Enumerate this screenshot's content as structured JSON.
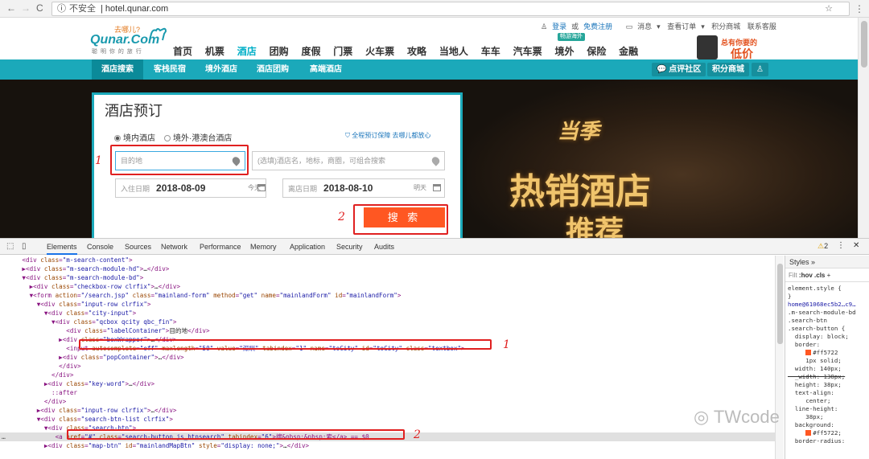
{
  "browser": {
    "back": "←",
    "forward": "→",
    "reload": "C",
    "security": "不安全",
    "url": "hotel.qunar.com",
    "star": "☆",
    "menu": "⋮"
  },
  "header": {
    "logo_top": "去哪儿?",
    "logo_main": "Qunar.Com",
    "logo_sub": "聪 明 你 的 旅 行",
    "top_links": {
      "login": "登录",
      "or": "或",
      "register": "免费注册",
      "messages": "消息",
      "orders": "查看订单",
      "points_mall": "积分商城",
      "service": "联系客服"
    },
    "ad_title": "总有你要的",
    "ad_price": "低价",
    "badge": "畅游海外"
  },
  "main_nav": [
    "首页",
    "机票",
    "酒店",
    "团购",
    "度假",
    "门票",
    "火车票",
    "攻略",
    "当地人",
    "车车",
    "汽车票",
    "境外",
    "保险",
    "金融"
  ],
  "main_nav_active": "酒店",
  "sub_nav": {
    "items": [
      "酒店搜索",
      "客栈民宿",
      "境外酒店",
      "酒店团购",
      "高端酒店"
    ],
    "active": "酒店搜索",
    "community": "点评社区",
    "points": "积分商城"
  },
  "booking": {
    "title": "酒店预订",
    "radio_domestic": "境内酒店",
    "radio_overseas": "境外·港澳台酒店",
    "guarantee": "全程预订保障 去哪儿都放心",
    "destination_placeholder": "目的地",
    "keyword_placeholder": "(选填)酒店名，地标，商圈，可组合搜索",
    "checkin_label": "入住日期",
    "checkin_date": "2018-08-09",
    "checkin_day": "今天",
    "checkout_label": "离店日期",
    "checkout_date": "2018-08-10",
    "checkout_day": "明天",
    "search": "搜 索"
  },
  "hero": {
    "line1": "当季",
    "line2": "热销酒店",
    "line3": "推荐"
  },
  "annotations": {
    "mark1": "1",
    "mark2": "2"
  },
  "devtools": {
    "tabs": [
      "Elements",
      "Console",
      "Sources",
      "Network",
      "Performance",
      "Memory",
      "Application",
      "Security",
      "Audits"
    ],
    "active_tab": "Elements",
    "warnings": "2",
    "styles_tab": "Styles",
    "filter": "Filt",
    "hov": ":hov",
    "cls": ".cls",
    "style_lines": [
      "element.style {",
      "}",
      "home@61068ec5b2…c9…",
      ".m-search-module-bd",
      ".search-btn",
      ".search-button {",
      "  display: block;",
      "  border:",
      "     #ff5722",
      "     1px solid;",
      "  width: 140px;",
      "  _width: 138px;",
      "  height: 38px;",
      "  text-align:",
      "     center;",
      "  line-height:",
      "     38px;",
      "  background:",
      "     #ff5722;",
      "  border-radius:"
    ],
    "watermark": "TWcode"
  },
  "dom_lines": [
    "      <div class=\"m-search-content\">",
    "      ▶<div class=\"m-search-module-hd\">…</div>",
    "      ▼<div class=\"m-search-module-bd\">",
    "        ▶<div class=\"checkbox-row clrfix\">…</div>",
    "        ▼<form action=\"/search.jsp\" class=\"mainland-form\" method=\"get\" name=\"mainlandForm\" id=\"mainlandForm\">",
    "          ▼<div class=\"input-row clrfix\">",
    "            ▼<div class=\"city-input\">",
    "              ▼<div class=\"qcbox qcity qbc_fin\">",
    "                  <div class=\"labelContainer\">目的地</div>",
    "                ▶<div class=\"boxWrapper\">…</div>",
    "                  <input autocomplete=\"off\" maxlength=\"50\" value=\"深圳\" tabindex=\"1\" name=\"toCity\" id=\"toCity\" class=\"textbox\">",
    "                ▶<div class=\"popContainer\">…</div>",
    "                </div>",
    "              </div>",
    "            ▶<div class=\"key-word\">…</div>",
    "              ::after",
    "            </div>",
    "          ▶<div class=\"input-row clrfix\">…</div>",
    "          ▼<div class=\"search-btn-list clrfix\">",
    "            ▼<div class=\"search-btn\">",
    "               <a href=\"#\" class=\"search-button js_btnsearch\" tabindex=\"6\">搜&nbsp;&nbsp;索</a> == $0",
    "            ▶<div class=\"map-btn\" id=\"mainlandMapBtn\" style=\"display: none;\">…</div>"
  ]
}
